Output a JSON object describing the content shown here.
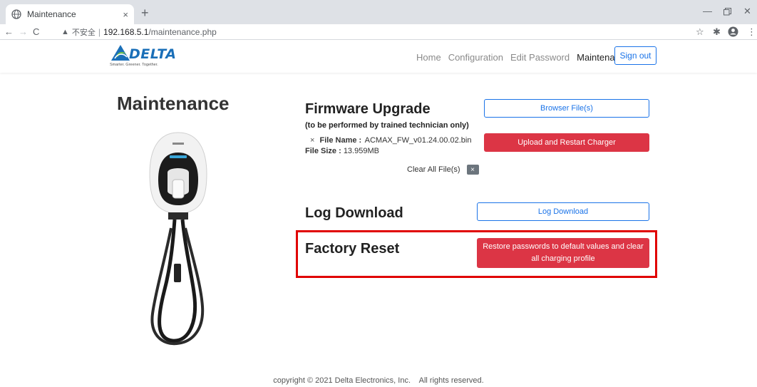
{
  "browser": {
    "tab_title": "Maintenance",
    "tab_close": "×",
    "new_tab": "+",
    "insecure_label": "不安全",
    "url_host": "192.168.5.1",
    "url_path": "/maintenance.php",
    "icons": [
      "globe-icon",
      "back-icon",
      "forward-icon",
      "reload-icon",
      "warning-icon",
      "star-icon",
      "extensions-icon",
      "profile-icon",
      "menu-icon",
      "minimize-icon",
      "maximize-icon",
      "close-icon"
    ]
  },
  "navbar": {
    "logo_text": "DELTA",
    "logo_tagline": "Smarter. Greener. Together.",
    "links": [
      "Home",
      "Configuration",
      "Edit Password",
      "Maintenance"
    ],
    "active_link": "Maintenance",
    "signout_label": "Sign out",
    "accent_color": "#1a73e8"
  },
  "main": {
    "title": "Maintenance",
    "firmware": {
      "heading": "Firmware Upgrade",
      "note": "(to be performed by trained technician only)",
      "file_name_label": "File Name :",
      "file_name": "ACMAX_FW_v01.24.00.02.bin",
      "file_size_label": "File Size :",
      "file_size": "13.959MB",
      "remove_file": "×",
      "clear_all_label": "Clear All File(s)",
      "clear_all_button": "×",
      "browse_button": "Browser File(s)",
      "upload_button": "Upload and Restart Charger"
    },
    "log": {
      "heading": "Log Download",
      "button": "Log Download"
    },
    "factory_reset": {
      "heading": "Factory Reset",
      "button": "Restore passwords to default values and clear all charging profile",
      "highlight_color": "#e00000"
    }
  },
  "footer": {
    "text": "copyright © 2021 Delta Electronics, Inc.    All rights reserved."
  }
}
